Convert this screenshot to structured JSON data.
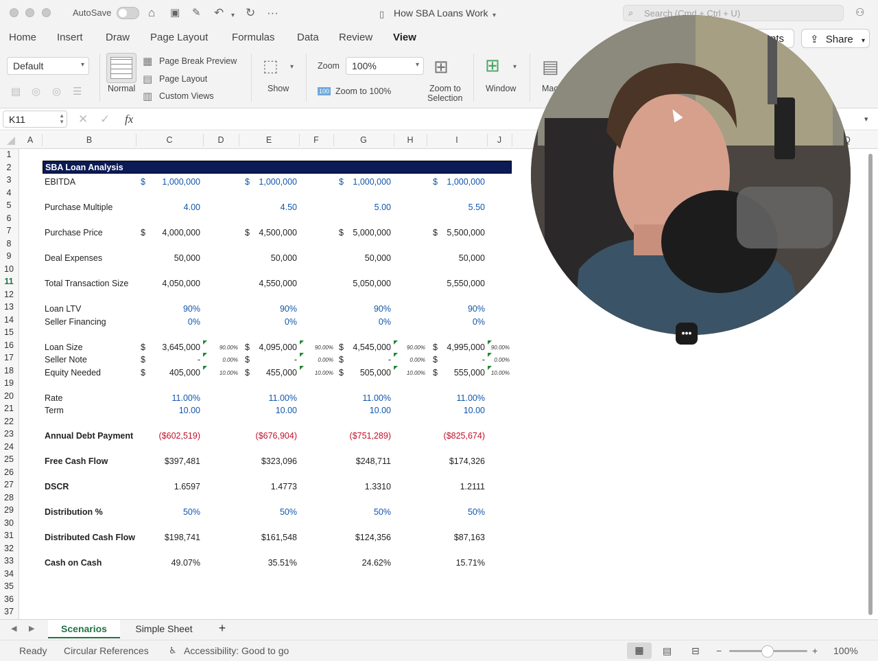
{
  "titlebar": {
    "autosave_label": "AutoSave",
    "doc_title": "How SBA Loans Work",
    "search_placeholder": "Search (Cmd + Ctrl + U)"
  },
  "ribbon_tabs": [
    "Home",
    "Insert",
    "Draw",
    "Page Layout",
    "Formulas",
    "Data",
    "Review",
    "View"
  ],
  "active_tab": "View",
  "share_label": "Share",
  "comments_label": "nts",
  "ribbon": {
    "sheet_view_value": "Default",
    "normal_label": "Normal",
    "page_break_label": "Page Break Preview",
    "page_layout_label": "Page Layout",
    "custom_views_label": "Custom Views",
    "show_label": "Show",
    "zoom_label": "Zoom",
    "zoom_value": "100%",
    "zoom100_badge": "100",
    "zoom100_label": "Zoom to 100%",
    "zoom_sel_line1": "Zoom to",
    "zoom_sel_line2": "Selection",
    "window_label": "Window",
    "macros_label": "Mac"
  },
  "formula_bar": {
    "name_box": "K11",
    "fx": "fx",
    "content": ""
  },
  "columns": [
    "A",
    "B",
    "C",
    "D",
    "E",
    "F",
    "G",
    "H",
    "I",
    "J",
    "Q"
  ],
  "rows": [
    "1",
    "2",
    "3",
    "4",
    "5",
    "6",
    "7",
    "8",
    "9",
    "10",
    "11",
    "12",
    "13",
    "14",
    "15",
    "16",
    "17",
    "18",
    "19",
    "20",
    "21",
    "22",
    "23",
    "24",
    "25",
    "26",
    "27",
    "28",
    "29",
    "30",
    "31",
    "32",
    "33",
    "34",
    "35",
    "36",
    "37"
  ],
  "active_row": "11",
  "sheet": {
    "title": "SBA Loan Analysis",
    "labels": {
      "ebitda": "EBITDA",
      "purchase_multiple": "Purchase Multiple",
      "purchase_price": "Purchase Price",
      "deal_expenses": "Deal Expenses",
      "total_transaction": "Total Transaction Size",
      "loan_ltv": "Loan LTV",
      "seller_financing": "Seller Financing",
      "loan_size": "Loan Size",
      "seller_note": "Seller Note",
      "equity_needed": "Equity Needed",
      "rate": "Rate",
      "term": "Term",
      "annual_debt": "Annual Debt Payment",
      "free_cash_flow": "Free Cash Flow",
      "dscr": "DSCR",
      "distribution_pct": "Distribution %",
      "distributed_cf": "Distributed Cash Flow",
      "cash_on_cash": "Cash on Cash"
    },
    "currency_symbol": "$",
    "scenarios": [
      {
        "ebitda": "1,000,000",
        "multiple": "4.00",
        "price": "4,000,000",
        "expenses": "50,000",
        "total": "4,050,000",
        "ltv": "90%",
        "seller_fin": "0%",
        "loan": "3,645,000",
        "loan_pct": "90.00%",
        "note": "-",
        "note_pct": "0.00%",
        "equity": "405,000",
        "equity_pct": "10.00%",
        "rate": "11.00%",
        "term": "10.00",
        "debt": "($602,519)",
        "fcf": "$397,481",
        "dscr": "1.6597",
        "dist_pct": "50%",
        "dist_cf": "$198,741",
        "coc": "49.07%"
      },
      {
        "ebitda": "1,000,000",
        "multiple": "4.50",
        "price": "4,500,000",
        "expenses": "50,000",
        "total": "4,550,000",
        "ltv": "90%",
        "seller_fin": "0%",
        "loan": "4,095,000",
        "loan_pct": "90.00%",
        "note": "-",
        "note_pct": "0.00%",
        "equity": "455,000",
        "equity_pct": "10.00%",
        "rate": "11.00%",
        "term": "10.00",
        "debt": "($676,904)",
        "fcf": "$323,096",
        "dscr": "1.4773",
        "dist_pct": "50%",
        "dist_cf": "$161,548",
        "coc": "35.51%"
      },
      {
        "ebitda": "1,000,000",
        "multiple": "5.00",
        "price": "5,000,000",
        "expenses": "50,000",
        "total": "5,050,000",
        "ltv": "90%",
        "seller_fin": "0%",
        "loan": "4,545,000",
        "loan_pct": "90.00%",
        "note": "-",
        "note_pct": "0.00%",
        "equity": "505,000",
        "equity_pct": "10.00%",
        "rate": "11.00%",
        "term": "10.00",
        "debt": "($751,289)",
        "fcf": "$248,711",
        "dscr": "1.3310",
        "dist_pct": "50%",
        "dist_cf": "$124,356",
        "coc": "24.62%"
      },
      {
        "ebitda": "1,000,000",
        "multiple": "5.50",
        "price": "5,500,000",
        "expenses": "50,000",
        "total": "5,550,000",
        "ltv": "90%",
        "seller_fin": "0%",
        "loan": "4,995,000",
        "loan_pct": "90.00%",
        "note": "-",
        "note_pct": "0.00%",
        "equity": "555,000",
        "equity_pct": "10.00%",
        "rate": "11.00%",
        "term": "10.00",
        "debt": "($825,674)",
        "fcf": "$174,326",
        "dscr": "1.2111",
        "dist_pct": "50%",
        "dist_cf": "$87,163",
        "coc": "15.71%"
      }
    ]
  },
  "sheet_tabs": [
    "Scenarios",
    "Simple Sheet"
  ],
  "add_sheet_label": "+",
  "status": {
    "ready": "Ready",
    "circular": "Circular References",
    "accessibility": "Accessibility: Good to go",
    "zoom": "100%"
  },
  "webcam_menu_label": "•••",
  "colors": {
    "accent": "#217346",
    "title_band": "#0c1a55",
    "input_blue": "#1155aa",
    "negative_red": "#c0102a"
  }
}
